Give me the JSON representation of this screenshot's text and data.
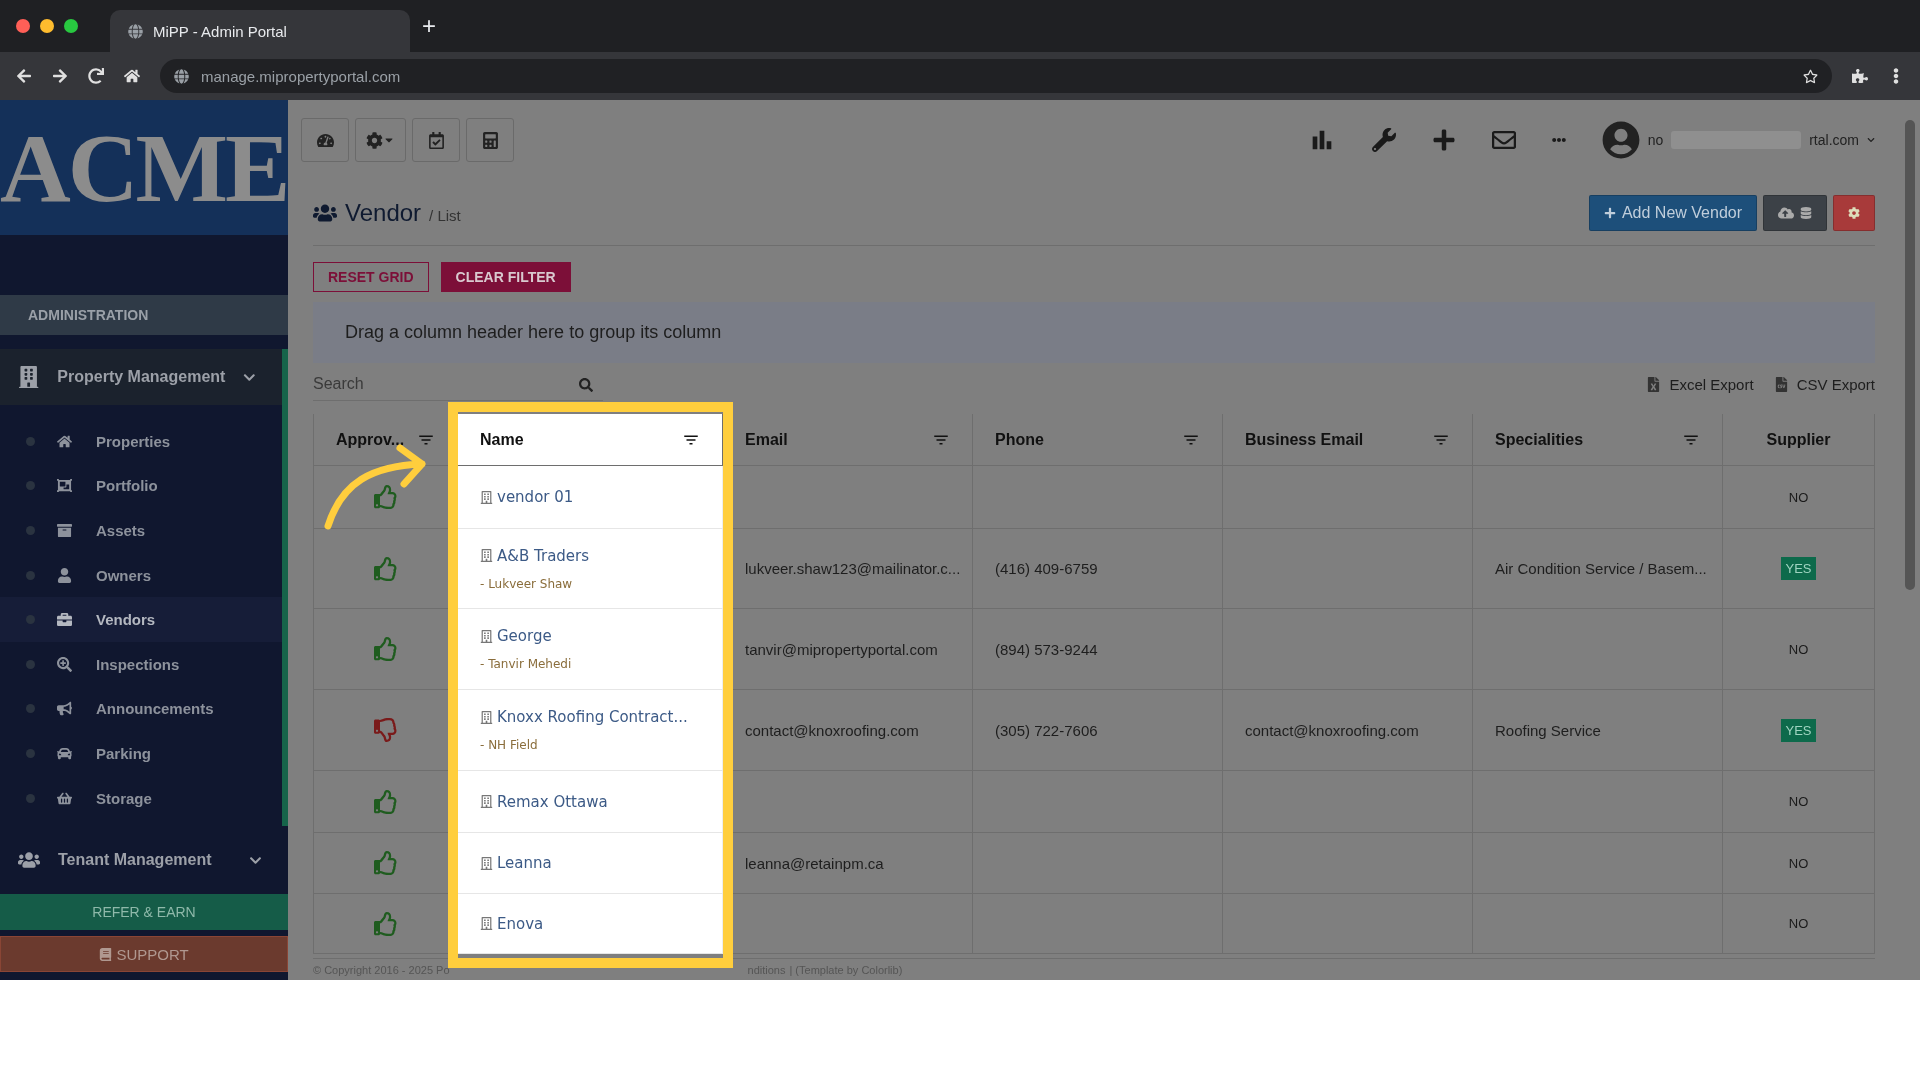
{
  "browser": {
    "tab_title": "MiPP - Admin Portal",
    "new_tab": "+",
    "address": "manage.mipropertyportal.com"
  },
  "sidebar": {
    "logo": "ACME",
    "section": "ADMINISTRATION",
    "groups": [
      {
        "label": "Property Management",
        "expanded": true,
        "items": [
          {
            "label": "Properties",
            "selected": false
          },
          {
            "label": "Portfolio",
            "selected": false
          },
          {
            "label": "Assets",
            "selected": false
          },
          {
            "label": "Owners",
            "selected": false
          },
          {
            "label": "Vendors",
            "selected": true
          },
          {
            "label": "Inspections",
            "selected": false
          },
          {
            "label": "Announcements",
            "selected": false
          },
          {
            "label": "Parking",
            "selected": false
          },
          {
            "label": "Storage",
            "selected": false
          }
        ]
      },
      {
        "label": "Tenant Management",
        "expanded": false
      }
    ],
    "refer": "REFER & EARN",
    "support": "SUPPORT"
  },
  "header": {
    "user_start": "no",
    "user_end": "rtal.com"
  },
  "page": {
    "title": "Vendor",
    "crumb": "/ List",
    "add_button": "Add New Vendor",
    "reset": "RESET GRID",
    "clear": "CLEAR FILTER",
    "group_hint": "Drag a column header here to group its column",
    "search_placeholder": "Search",
    "exports": [
      "Excel Export",
      "CSV Export"
    ]
  },
  "table": {
    "columns": [
      {
        "label": "Approv...",
        "filter": true
      },
      {
        "label": "Name",
        "filter": true
      },
      {
        "label": "Email",
        "filter": true
      },
      {
        "label": "Phone",
        "filter": true
      },
      {
        "label": "Business Email",
        "filter": true
      },
      {
        "label": "Specialities",
        "filter": true
      },
      {
        "label": "Supplier",
        "filter": false
      }
    ],
    "rows": [
      {
        "approved": true,
        "name": "vendor 01",
        "contact": "",
        "email": "",
        "phone": "",
        "business_email": "",
        "specialities": "",
        "supplier": "NO",
        "is_supplier": false
      },
      {
        "approved": true,
        "name": "A&B Traders",
        "contact": "- Lukveer Shaw",
        "email": "lukveer.shaw123@mailinator.c...",
        "phone": "(416) 409-6759",
        "business_email": "",
        "specialities": "Air Condition Service / Basem...",
        "supplier": "YES",
        "is_supplier": true
      },
      {
        "approved": true,
        "name": "George",
        "contact": "- Tanvir Mehedi",
        "email": "tanvir@mipropertyportal.com",
        "phone": "(894) 573-9244",
        "business_email": "",
        "specialities": "",
        "supplier": "NO",
        "is_supplier": false
      },
      {
        "approved": false,
        "name": "Knoxx Roofing Contract...",
        "contact": "- NH Field",
        "email": "contact@knoxroofing.com",
        "phone": "(305) 722-7606",
        "business_email": "contact@knoxroofing.com",
        "specialities": "Roofing Service",
        "supplier": "YES",
        "is_supplier": true
      },
      {
        "approved": true,
        "name": "Remax Ottawa",
        "contact": "",
        "email": "",
        "phone": "",
        "business_email": "",
        "specialities": "",
        "supplier": "NO",
        "is_supplier": false
      },
      {
        "approved": true,
        "name": "Leanna",
        "contact": "",
        "email": "leanna@retainpm.ca",
        "phone": "",
        "business_email": "",
        "specialities": "",
        "supplier": "NO",
        "is_supplier": false
      },
      {
        "approved": true,
        "name": "Enova",
        "contact": "",
        "email": "",
        "phone": "",
        "business_email": "",
        "specialities": "",
        "supplier": "NO",
        "is_supplier": false
      }
    ]
  },
  "footer": {
    "left": "© Copyright 2016 - 2025 Po",
    "right": "nditions",
    "credit": "| (Template by Colorlib)"
  }
}
